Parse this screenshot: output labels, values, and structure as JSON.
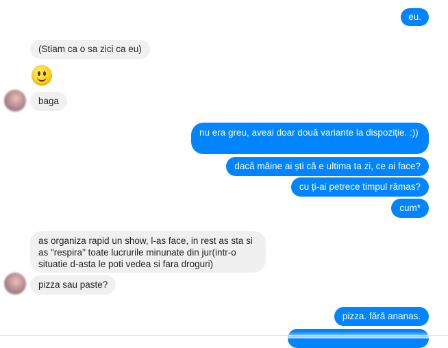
{
  "messages": [
    {
      "id": "m1",
      "side": "out",
      "text": "eu."
    },
    {
      "id": "m2",
      "side": "in",
      "text": "(Stiam ca o sa zici ca eu)"
    },
    {
      "id": "m3",
      "side": "in",
      "emoji": "slightly-smiling-face-icon"
    },
    {
      "id": "m4",
      "side": "in",
      "text": "baga"
    },
    {
      "id": "m5",
      "side": "out",
      "text": "nu era greu, aveai doar două variante la dispoziție. :))"
    },
    {
      "id": "m6",
      "side": "out",
      "text": "dacă mâine ai ști că e ultima ta zi, ce ai face?"
    },
    {
      "id": "m7",
      "side": "out",
      "text": "cu ți-ai petrece timpul rămas?"
    },
    {
      "id": "m8",
      "side": "out",
      "text": "cum*"
    },
    {
      "id": "m9",
      "side": "in",
      "text": "as organiza rapid un show, l-as face, in rest as sta si as \"respira\" toate lucrurile minunate din jur(intr-o situatie d-asta le poti vedea si fara droguri)"
    },
    {
      "id": "m10",
      "side": "in",
      "text": "pizza sau paste?"
    },
    {
      "id": "m11",
      "side": "out",
      "text": "pizza. fără ananas."
    }
  ],
  "colors": {
    "outgoing": "#0084ff",
    "incoming": "#f1f0f0"
  }
}
